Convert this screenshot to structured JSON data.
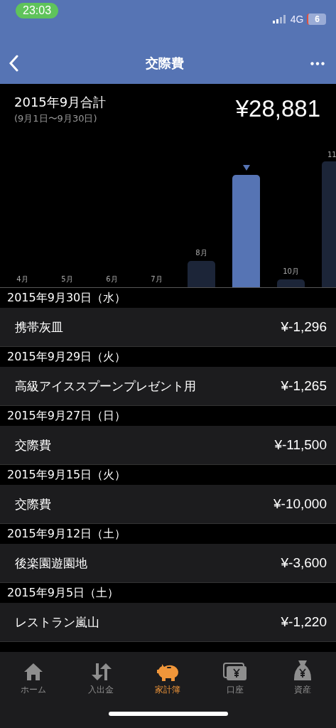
{
  "status_bar": {
    "time": "23:03",
    "network": "4G",
    "battery": "6"
  },
  "nav": {
    "title": "交際費"
  },
  "summary": {
    "title": "2015年9月合計",
    "range": "(9月1日〜9月30日)",
    "total": "¥28,881"
  },
  "months": [
    {
      "label": "4月",
      "selected": false
    },
    {
      "label": "5月",
      "selected": false
    },
    {
      "label": "6月",
      "selected": false
    },
    {
      "label": "7月",
      "selected": false
    },
    {
      "label": "8月",
      "selected": false
    },
    {
      "selected": true
    },
    {
      "label": "10月",
      "selected": false
    },
    {
      "label": "11",
      "selected": false
    }
  ],
  "days": [
    {
      "date": "2015年9月30日（水）",
      "items": [
        {
          "name": "携帯灰皿",
          "amount": "¥-1,296"
        }
      ]
    },
    {
      "date": "2015年9月29日（火）",
      "items": [
        {
          "name": "高級アイススプーンプレゼント用",
          "amount": "¥-1,265"
        }
      ]
    },
    {
      "date": "2015年9月27日（日）",
      "items": [
        {
          "name": "交際費",
          "amount": "¥-11,500"
        }
      ]
    },
    {
      "date": "2015年9月15日（火）",
      "items": [
        {
          "name": "交際費",
          "amount": "¥-10,000"
        }
      ]
    },
    {
      "date": "2015年9月12日（土）",
      "items": [
        {
          "name": "後楽園遊園地",
          "amount": "¥-3,600"
        }
      ]
    },
    {
      "date": "2015年9月5日（土）",
      "items": [
        {
          "name": "レストラン嵐山",
          "amount": "¥-1,220"
        }
      ]
    }
  ],
  "tab_bar": [
    {
      "kind": "home",
      "label": "ホーム",
      "selected": false
    },
    {
      "kind": "transfer",
      "label": "入出金",
      "selected": false
    },
    {
      "kind": "budget",
      "label": "家計簿",
      "selected": true
    },
    {
      "kind": "account",
      "label": "口座",
      "selected": false
    },
    {
      "kind": "assets",
      "label": "資産",
      "selected": false
    }
  ]
}
